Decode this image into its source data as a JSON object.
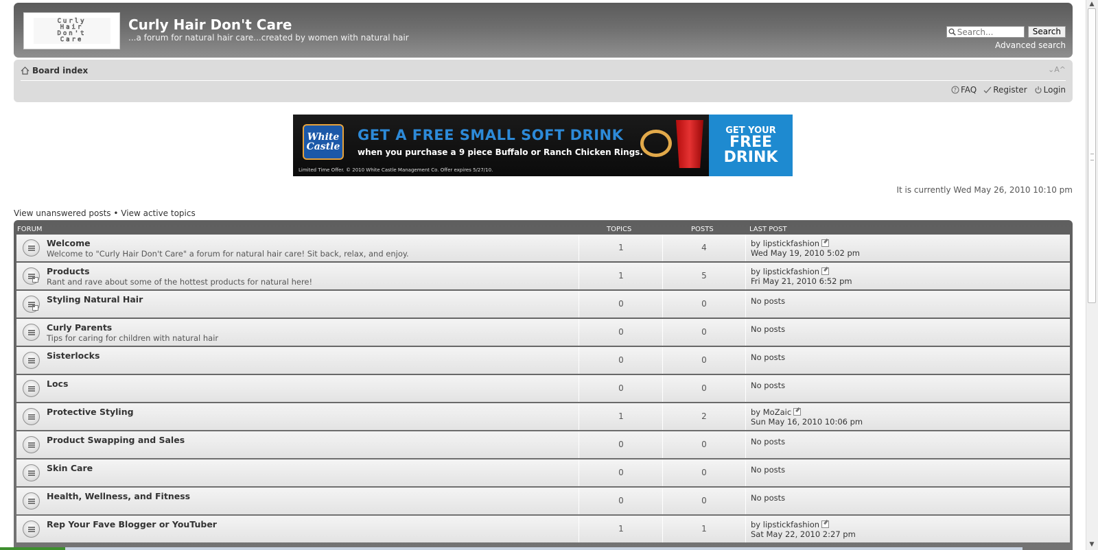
{
  "header": {
    "logo_lines": [
      "Curly",
      "Hair",
      "Don't",
      "Care"
    ],
    "title": "Curly Hair Don't Care",
    "description": "...a forum for natural hair care...created by women with natural hair",
    "search_placeholder": "Search...",
    "search_button": "Search",
    "advanced_search": "Advanced search"
  },
  "navbar": {
    "breadcrumb": "Board index",
    "font_controls": "⌄A^",
    "links": [
      "FAQ",
      "Register",
      "Login"
    ]
  },
  "banner": {
    "brand_line1": "White",
    "brand_line2": "Castle",
    "headline": "GET A FREE SMALL SOFT DRINK",
    "subline": "when you purchase a 9 piece Buffalo or Ranch Chicken Rings.",
    "fine_print": "Limited Time Offer. © 2010 White Castle Management Co. Offer expires 5/27/10.",
    "cta_line1": "GET YOUR",
    "cta_line2": "FREE",
    "cta_line3": "DRINK"
  },
  "current_time": "It is currently Wed May 26, 2010 10:10 pm",
  "quick_links": {
    "unanswered": "View unanswered posts",
    "separator": "•",
    "active": "View active topics"
  },
  "table": {
    "headers": {
      "forum": "FORUM",
      "topics": "TOPICS",
      "posts": "POSTS",
      "last_post": "LAST POST"
    },
    "rows": [
      {
        "name": "Welcome",
        "desc": "Welcome to \"Curly Hair Don't Care\" a forum for natural hair care! Sit back, relax, and enjoy.",
        "topics": "1",
        "posts": "4",
        "last_by": "by lipstickfashion",
        "last_date": "Wed May 19, 2010 5:02 pm",
        "no_posts": ""
      },
      {
        "name": "Products",
        "desc": "Rant and rave about some of the hottest products for natural here!",
        "topics": "1",
        "posts": "5",
        "last_by": "by lipstickfashion",
        "last_date": "Fri May 21, 2010 6:52 pm",
        "no_posts": ""
      },
      {
        "name": "Styling Natural Hair",
        "desc": "",
        "topics": "0",
        "posts": "0",
        "last_by": "",
        "last_date": "",
        "no_posts": "No posts"
      },
      {
        "name": "Curly Parents",
        "desc": "Tips for caring for children with natural hair",
        "topics": "0",
        "posts": "0",
        "last_by": "",
        "last_date": "",
        "no_posts": "No posts"
      },
      {
        "name": "Sisterlocks",
        "desc": "",
        "topics": "0",
        "posts": "0",
        "last_by": "",
        "last_date": "",
        "no_posts": "No posts"
      },
      {
        "name": "Locs",
        "desc": "",
        "topics": "0",
        "posts": "0",
        "last_by": "",
        "last_date": "",
        "no_posts": "No posts"
      },
      {
        "name": "Protective Styling",
        "desc": "",
        "topics": "1",
        "posts": "2",
        "last_by": "by MoZaic",
        "last_date": "Sun May 16, 2010 10:06 pm",
        "no_posts": ""
      },
      {
        "name": "Product Swapping and Sales",
        "desc": "",
        "topics": "0",
        "posts": "0",
        "last_by": "",
        "last_date": "",
        "no_posts": "No posts"
      },
      {
        "name": "Skin Care",
        "desc": "",
        "topics": "0",
        "posts": "0",
        "last_by": "",
        "last_date": "",
        "no_posts": "No posts"
      },
      {
        "name": "Health, Wellness, and Fitness",
        "desc": "",
        "topics": "0",
        "posts": "0",
        "last_by": "",
        "last_date": "",
        "no_posts": "No posts"
      },
      {
        "name": "Rep Your Fave Blogger or YouTuber",
        "desc": "",
        "topics": "1",
        "posts": "1",
        "last_by": "by lipstickfashion",
        "last_date": "Sat May 22, 2010 2:27 pm",
        "no_posts": ""
      }
    ]
  },
  "colors": {
    "header_dark": "#5b5b5b",
    "navbar_bg": "#dcdcdc",
    "banner_blue": "#1e8ad0"
  }
}
